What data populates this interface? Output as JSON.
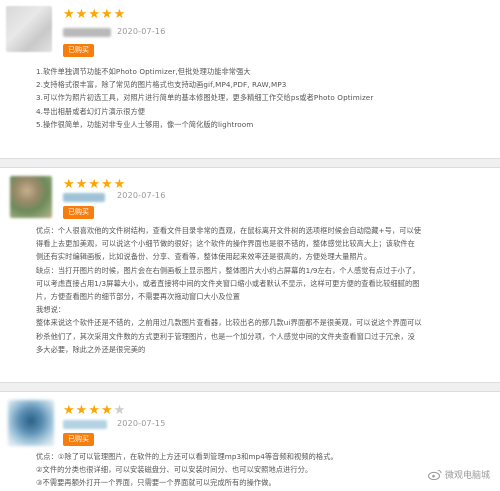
{
  "reviews": [
    {
      "stars": 5,
      "date": "2020-07-16",
      "badge": "已购买",
      "lines": [
        "1.软件单独调节功能不如Photo Optimizer,但批处理功能非常强大",
        "2.支持格式很丰富，除了常见的图片格式也支持动画gif,MP4,PDF, RAW,MP3",
        "3.可以作为照片初选工具，对照片进行简单的基本修图处理，更多精细工作交给ps或者Photo Optimizer",
        "4.导出相册或者幻灯片演示很方便",
        "5.操作很简单，功能对非专业人士够用，像一个简化版的lightroom"
      ]
    },
    {
      "stars": 5,
      "date": "2020-07-16",
      "badge": "已购买",
      "lines": [
        "优点：个人很喜欢他的文件树结构，查看文件目录非常的直观，在鼠标离开文件树的选项框时候会自动隐藏+号，可以使",
        "得看上去更加美观，可以说这个小细节做的很好；这个软件的操作界面也是很不错的，整体感觉比较高大上；该软件在",
        "侧还有实时编辑画板，比如说备份、分享、查看等，整体使用起来效率还是很高的，方便处理大量照片。",
        "缺点：当打开图片的时候，图片会在右侧画板上显示图片，整体图片大小约占屏幕的1/9左右，个人感觉有点过于小了，",
        "可以考虑直接占用1/3屏幕大小，或者直接将中间的文件夹窗口缩小或者默认不显示，这样可更方便的查看比较细腻的图",
        "片，方便查看图片的细节部分，不需要再次拖动窗口大小及位置",
        "我想说：",
        "整体来说这个软件还是不错的，之前用过几款图片查看器，比较出名的那几款ui界面都不是很美观，可以说这个界面可以",
        "秒杀他们了，其次采用文件数的方式更利于管理图片，也是一个加分项，个人感觉中间的文件夹查看窗口过于冗余，没",
        "多大必要，除此之外还是很完美的"
      ]
    },
    {
      "stars": 4,
      "date": "2020-07-15",
      "badge": "已购买",
      "lines": [
        "优点：①除了可以管理图片，在软件的上方还可以看到管理mp3和mp4等音频和视频的格式。",
        "②文件的分类也很详细，可以安装磁盘分、可以安装时间分、也可以安照地点进行分。",
        "③不需要再额外打开一个界面，只需要一个界面就可以完成所有的操作做。"
      ]
    }
  ],
  "watermark": "微观电脑城",
  "colors": {
    "star": "#ffa500",
    "star_empty": "#cccccc",
    "badge": "#f77e0c"
  }
}
